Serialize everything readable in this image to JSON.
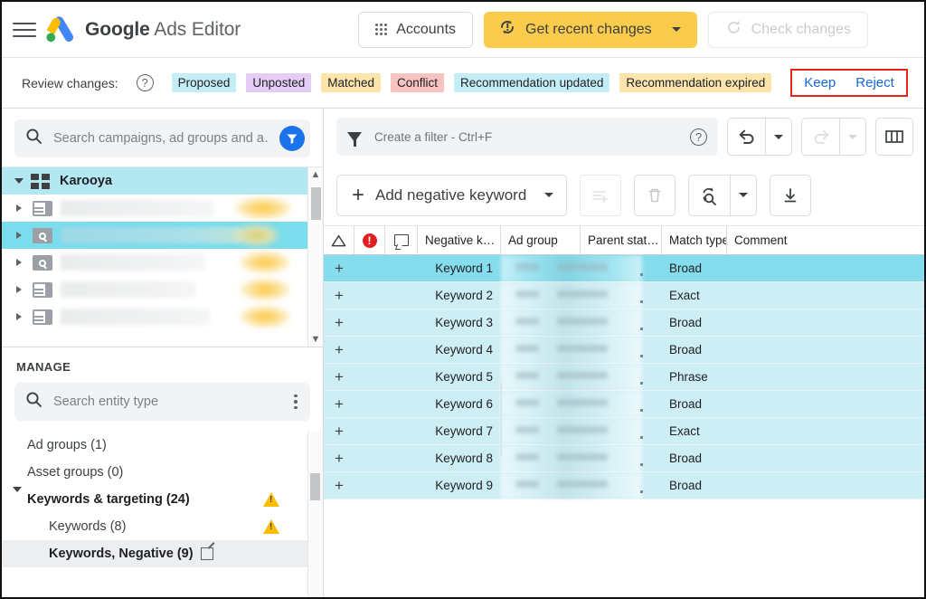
{
  "app": {
    "title_bold": "Google",
    "title_rest": " Ads Editor",
    "menu_icon": "hamburger-icon",
    "logo_icon": "google-ads-logo"
  },
  "topbar": {
    "accounts_label": "Accounts",
    "accounts_icon": "apps-grid-icon",
    "get_recent_changes_label": "Get recent changes",
    "get_recent_changes_icon": "sync-alert-icon",
    "get_recent_changes_caret": "chevron-down-icon",
    "check_changes_label": "Check changes",
    "check_changes_icon": "refresh-icon",
    "check_changes_disabled": true,
    "amber": "#fbcb4b"
  },
  "review_bar": {
    "label": "Review changes:",
    "help_icon": "help-circle-icon",
    "chips": [
      {
        "label": "Proposed",
        "bg": "#c5edf5"
      },
      {
        "label": "Unposted",
        "bg": "#e4ccf7"
      },
      {
        "label": "Matched",
        "bg": "#fbe5ab"
      },
      {
        "label": "Conflict",
        "bg": "#f6c3c0"
      },
      {
        "label": "Recommendation updated",
        "bg": "#c5edf5"
      },
      {
        "label": "Recommendation expired",
        "bg": "#fbe5ab"
      }
    ],
    "keep_label": "Keep",
    "reject_label": "Reject",
    "highlight_color": "#e8241a",
    "link_color": "#1967d2"
  },
  "left_panel": {
    "search": {
      "placeholder": "Search campaigns, ad groups and a…",
      "value": "",
      "icon": "search-icon",
      "filter_icon": "filter-funnel-icon"
    },
    "tree": [
      {
        "label": "Karooya",
        "icon": "account-icon",
        "level": 0,
        "expanded": true,
        "selected": false,
        "root": true,
        "blurred": false
      },
      {
        "label": "",
        "icon": "display-campaign-icon",
        "level": 1,
        "expanded": false,
        "selected": false,
        "root": false,
        "blurred": true
      },
      {
        "label": "",
        "icon": "search-campaign-icon",
        "level": 1,
        "expanded": false,
        "selected": true,
        "root": false,
        "blurred": true
      },
      {
        "label": "",
        "icon": "search-campaign-icon",
        "level": 1,
        "expanded": false,
        "selected": false,
        "root": false,
        "blurred": true
      },
      {
        "label": "",
        "icon": "display-campaign-icon",
        "level": 1,
        "expanded": false,
        "selected": false,
        "root": false,
        "blurred": true
      },
      {
        "label": "",
        "icon": "display-campaign-icon",
        "level": 1,
        "expanded": false,
        "selected": false,
        "root": false,
        "blurred": true
      }
    ],
    "manage_header": "MANAGE",
    "entity_search": {
      "placeholder": "Search entity type",
      "value": "",
      "icon": "search-icon",
      "menu_icon": "kebab-menu-icon"
    },
    "entities": [
      {
        "label": "Ad groups (1)",
        "level": 1,
        "bold": false,
        "warn": false,
        "active": false,
        "caret": false,
        "external": false
      },
      {
        "label": "Asset groups (0)",
        "level": 1,
        "bold": false,
        "warn": false,
        "active": false,
        "caret": false,
        "external": false
      },
      {
        "label": "Keywords & targeting (24)",
        "level": 1,
        "bold": true,
        "warn": true,
        "active": false,
        "caret": true,
        "external": false
      },
      {
        "label": "Keywords (8)",
        "level": 2,
        "bold": false,
        "warn": true,
        "active": false,
        "caret": false,
        "external": false
      },
      {
        "label": "Keywords, Negative (9)",
        "level": 2,
        "bold": true,
        "warn": false,
        "active": true,
        "caret": false,
        "external": true
      }
    ]
  },
  "main_panel": {
    "filter": {
      "placeholder": "Create a filter - Ctrl+F",
      "value": "",
      "icon": "filter-funnel-icon",
      "help_icon": "help-circle-icon"
    },
    "toolbar": {
      "undo_icon": "undo-icon",
      "undo_caret": "chevron-down-icon",
      "redo_icon": "redo-icon",
      "redo_caret": "chevron-down-icon",
      "columns_icon": "columns-icon",
      "add_negative_keyword_label": "Add negative keyword",
      "add_caret": "chevron-down-icon",
      "make_multiple_changes_icon": "list-add-icon",
      "delete_icon": "trash-icon",
      "replace_icon": "find-replace-icon",
      "replace_caret": "chevron-down-icon",
      "export_icon": "download-icon"
    },
    "table": {
      "columns": [
        {
          "key": "delta",
          "label": "",
          "icon": "triangle-changes-icon"
        },
        {
          "key": "error",
          "label": "",
          "icon": "error-circle-icon"
        },
        {
          "key": "comment",
          "label": "",
          "icon": "comment-bubble-icon"
        },
        {
          "key": "keyword",
          "label": "Negative k…",
          "icon": ""
        },
        {
          "key": "adgroup",
          "label": "Ad group",
          "icon": ""
        },
        {
          "key": "parent",
          "label": "Parent stat…",
          "icon": ""
        },
        {
          "key": "match",
          "label": "Match type",
          "icon": ""
        },
        {
          "key": "commentcol",
          "label": "Comment",
          "icon": ""
        }
      ],
      "rows": [
        {
          "delta": "+",
          "keyword": "Keyword 1",
          "adgroup": "",
          "parent": "",
          "match": "Broad",
          "comment": "",
          "selected": true
        },
        {
          "delta": "+",
          "keyword": "Keyword 2",
          "adgroup": "",
          "parent": "",
          "match": "Exact",
          "comment": "",
          "selected": false
        },
        {
          "delta": "+",
          "keyword": "Keyword 3",
          "adgroup": "",
          "parent": "",
          "match": "Broad",
          "comment": "",
          "selected": false
        },
        {
          "delta": "+",
          "keyword": "Keyword 4",
          "adgroup": "",
          "parent": "",
          "match": "Broad",
          "comment": "",
          "selected": false
        },
        {
          "delta": "+",
          "keyword": "Keyword 5",
          "adgroup": "",
          "parent": "",
          "match": "Phrase",
          "comment": "",
          "selected": false
        },
        {
          "delta": "+",
          "keyword": "Keyword 6",
          "adgroup": "",
          "parent": "",
          "match": "Broad",
          "comment": "",
          "selected": false
        },
        {
          "delta": "+",
          "keyword": "Keyword 7",
          "adgroup": "",
          "parent": "",
          "match": "Exact",
          "comment": "",
          "selected": false
        },
        {
          "delta": "+",
          "keyword": "Keyword 8",
          "adgroup": "",
          "parent": "",
          "match": "Broad",
          "comment": "",
          "selected": false
        },
        {
          "delta": "+",
          "keyword": "Keyword 9",
          "adgroup": "",
          "parent": "",
          "match": "Broad",
          "comment": "",
          "selected": false
        }
      ],
      "row_bg": "#cdeef5",
      "selected_row_bg": "#84dced"
    }
  }
}
